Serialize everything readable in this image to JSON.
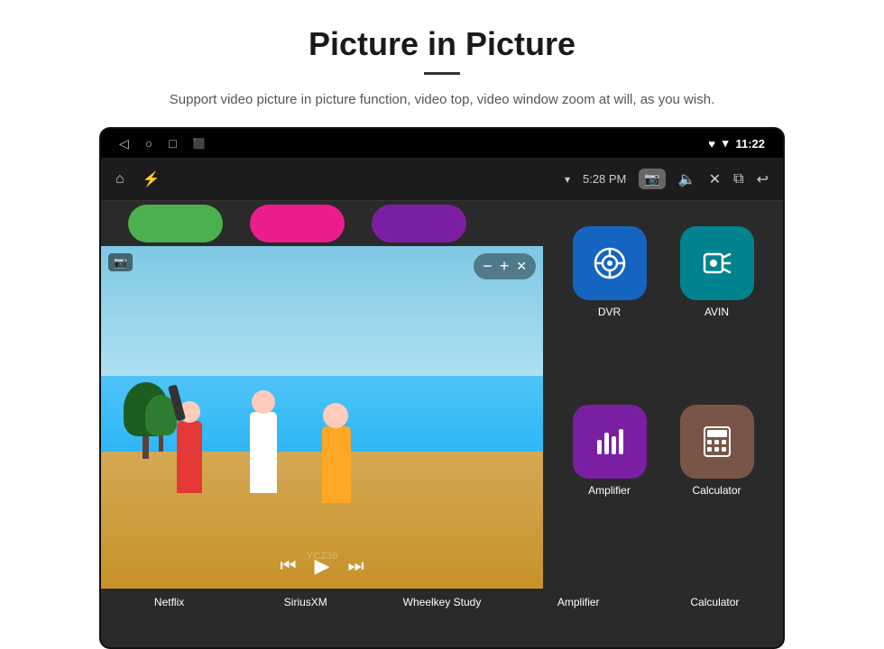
{
  "header": {
    "title": "Picture in Picture",
    "description": "Support video picture in picture function, video top, video window zoom at will, as you wish."
  },
  "statusBar": {
    "time": "11:22",
    "navIcons": [
      "◁",
      "○",
      "□",
      "⬛"
    ],
    "rightIcons": [
      "♥",
      "▾"
    ]
  },
  "navBar": {
    "homeIcon": "⌂",
    "usbIcon": "⚡",
    "time": "5:28 PM",
    "cameraIcon": "📷",
    "volumeIcon": "🔈",
    "closeIcon": "✕",
    "windowIcon": "⧉",
    "backIcon": "↩"
  },
  "apps": {
    "topRow": [
      {
        "label": "",
        "color": "green"
      },
      {
        "label": "",
        "color": "pink"
      },
      {
        "label": "",
        "color": "purple"
      }
    ],
    "grid": [
      {
        "id": "dvr",
        "label": "DVR",
        "color": "blue",
        "icon": "dvr"
      },
      {
        "id": "avin",
        "label": "AVIN",
        "color": "teal",
        "icon": "avin"
      },
      {
        "id": "amplifier",
        "label": "Amplifier",
        "color": "purple",
        "icon": "amp"
      },
      {
        "id": "calculator",
        "label": "Calculator",
        "color": "brown",
        "icon": "calc"
      }
    ],
    "bottomRow": [
      {
        "label": "Netflix"
      },
      {
        "label": "SiriusXM"
      },
      {
        "label": "Wheelkey Study"
      },
      {
        "label": "Amplifier"
      },
      {
        "label": "Calculator"
      }
    ]
  },
  "pip": {
    "cameraLabel": "📷",
    "minusLabel": "−",
    "plusLabel": "+",
    "closeLabel": "✕",
    "rewindLabel": "⏮",
    "playLabel": "▶",
    "forwardLabel": "⏭"
  },
  "watermark": "YCZ39"
}
